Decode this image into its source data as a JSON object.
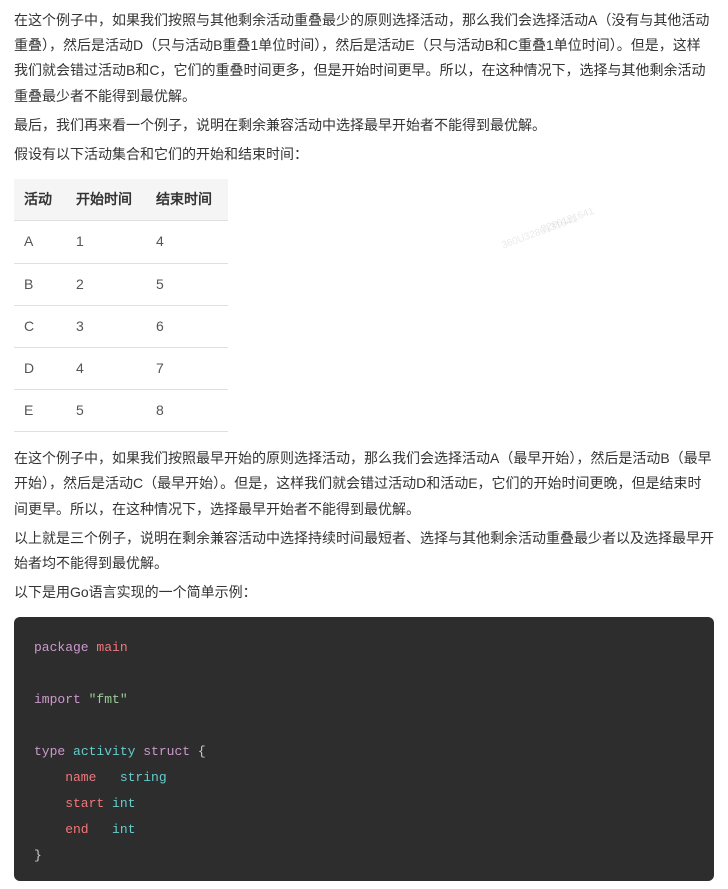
{
  "paragraphs": {
    "p1": "在这个例子中，如果我们按照与其他剩余活动重叠最少的原则选择活动，那么我们会选择活动A（没有与其他活动重叠），然后是活动D（只与活动B重叠1单位时间），然后是活动E（只与活动B和C重叠1单位时间）。但是，这样我们就会错过活动B和C，它们的重叠时间更多，但是开始时间更早。所以，在这种情况下，选择与其他剩余活动重叠最少者不能得到最优解。",
    "p2": "最后，我们再来看一个例子，说明在剩余兼容活动中选择最早开始者不能得到最优解。",
    "p3": "假设有以下活动集合和它们的开始和结束时间：",
    "p4": "在这个例子中，如果我们按照最早开始的原则选择活动，那么我们会选择活动A（最早开始），然后是活动B（最早开始），然后是活动C（最早开始）。但是，这样我们就会错过活动D和活动E，它们的开始时间更晚，但是结束时间更早。所以，在这种情况下，选择最早开始者不能得到最优解。",
    "p5": "以上就是三个例子，说明在剩余兼容活动中选择持续时间最短者、选择与其他剩余活动重叠最少者以及选择最早开始者均不能得到最优解。",
    "p6": "以下是用Go语言实现的一个简单示例："
  },
  "table": {
    "headers": {
      "h1": "活动",
      "h2": "开始时间",
      "h3": "结束时间"
    },
    "rows": [
      {
        "c1": "A",
        "c2": "1",
        "c3": "4"
      },
      {
        "c1": "B",
        "c2": "2",
        "c3": "5"
      },
      {
        "c1": "C",
        "c2": "3",
        "c3": "6"
      },
      {
        "c1": "D",
        "c2": "4",
        "c3": "7"
      },
      {
        "c1": "E",
        "c2": "5",
        "c3": "8"
      }
    ]
  },
  "code": {
    "l1_kw": "package",
    "l1_pkg": " main",
    "l2_kw": "import",
    "l2_str": " \"fmt\"",
    "l3_kw1": "type",
    "l3_name": " activity",
    "l3_kw2": " struct",
    "l3_brace": " {",
    "l4_field": "    name  ",
    "l4_type": " string",
    "l5_field": "    start",
    "l5_type": " int",
    "l6_field": "    end  ",
    "l6_type": " int",
    "l7_brace": "}"
  },
  "watermark": {
    "w1": "3286131641",
    "w2": "360U3286131641"
  }
}
